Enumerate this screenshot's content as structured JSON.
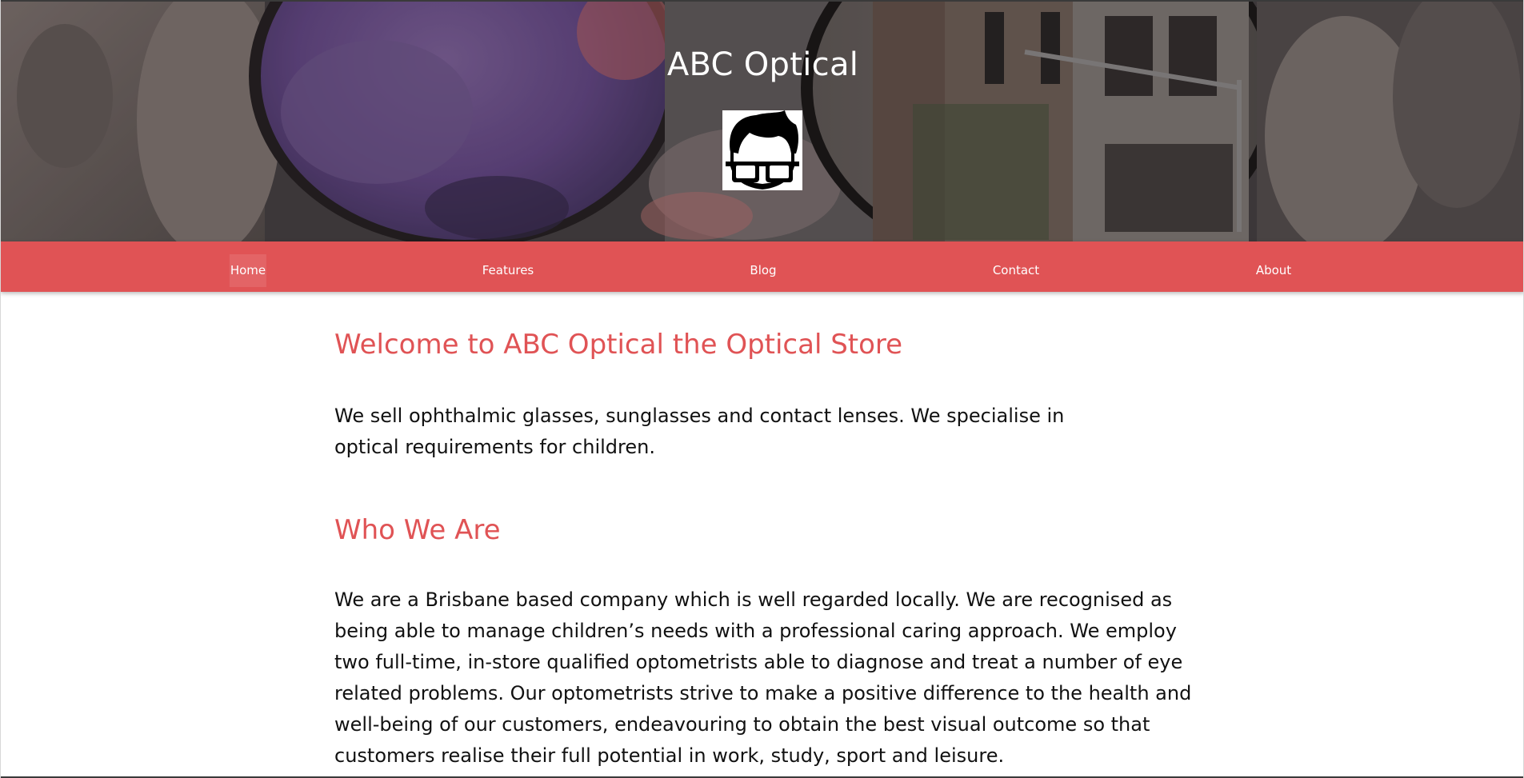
{
  "header": {
    "site_title": "ABC Optical",
    "logo_icon": "nerd-glasses-face-icon"
  },
  "nav": {
    "items": [
      {
        "label": "Home",
        "active": true
      },
      {
        "label": "Features",
        "active": false
      },
      {
        "label": "Blog",
        "active": false
      },
      {
        "label": "Contact",
        "active": false
      },
      {
        "label": "About",
        "active": false
      }
    ]
  },
  "main": {
    "welcome_heading": "Welcome to ABC Optical the Optical Store",
    "intro_text": "We sell ophthalmic glasses, sunglasses and contact lenses. We specialise in optical requirements for children.",
    "who_heading": "Who We Are",
    "who_text": "We are a Brisbane based company which is well regarded locally. We are recognised as being able to manage children’s needs with a professional caring approach. We employ two full-time, in-store qualified optometrists able to diagnose and treat a number of eye related problems. Our optometrists strive to make a positive difference to the health and well-being of our customers, endeavouring to obtain the best visual outcome so that customers realise their full potential in work, study, sport and leisure."
  },
  "colors": {
    "brand_accent": "#e05355",
    "nav_text": "#ffffff",
    "body_text": "#111111"
  }
}
